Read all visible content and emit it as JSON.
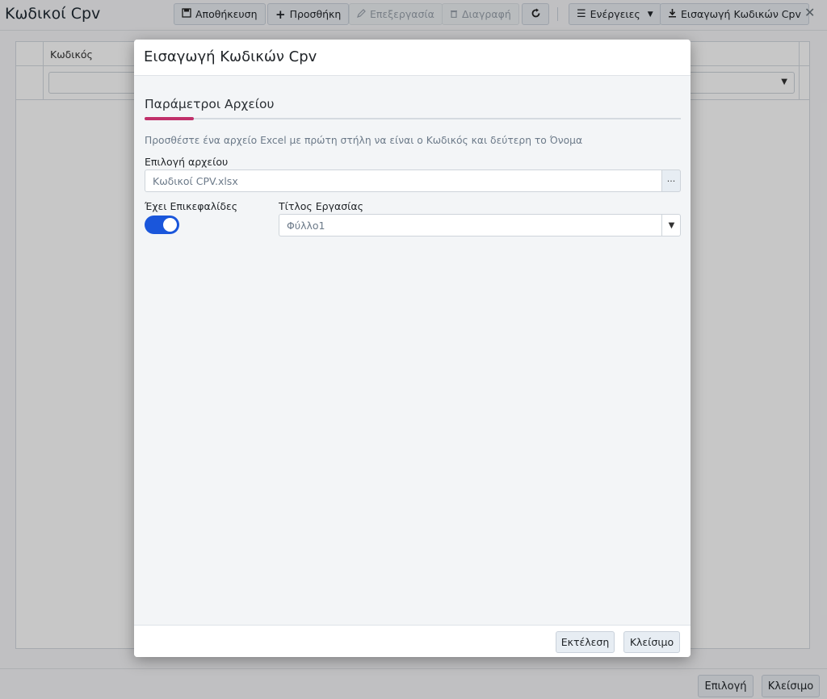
{
  "app": {
    "title": "Κωδικοί Cpv",
    "close_glyph": "✕"
  },
  "toolbar": {
    "save": {
      "label": "Αποθήκευση",
      "icon": "save-icon"
    },
    "add": {
      "label": "Προσθήκη",
      "icon": "plus-icon"
    },
    "edit": {
      "label": "Επεξεργασία",
      "icon": "pencil-icon",
      "disabled": true
    },
    "delete": {
      "label": "Διαγραφή",
      "icon": "trash-icon",
      "disabled": true
    },
    "refresh": {
      "icon": "refresh-icon"
    },
    "actions": {
      "label": "Ενέργειες",
      "icon": "menu-icon"
    },
    "import": {
      "label": "Εισαγωγή Κωδικών Cpv",
      "icon": "download-icon"
    }
  },
  "grid": {
    "columns": [
      "Κωδικός"
    ]
  },
  "bottom": {
    "select_label": "Επιλογή",
    "close_label": "Κλείσιμο"
  },
  "modal": {
    "title": "Εισαγωγή Κωδικών Cpv",
    "section_title": "Παράμετροι Αρχείου",
    "hint": "Προσθέστε ένα αρχείο Excel με πρώτη στήλη να είναι ο Κωδικός και δεύτερη το Όνομα",
    "file_label": "Επιλογή αρχείου",
    "file_value": "Κωδικοί CPV.xlsx",
    "file_button": "···",
    "headers_label": "Έχει Επικεφαλίδες",
    "headers_on": true,
    "sheet_label": "Τίτλος Εργασίας",
    "sheet_value": "Φύλλο1",
    "execute_label": "Εκτέλεση",
    "close_label": "Κλείσιμο"
  },
  "colors": {
    "accent": "#c0306a",
    "toggle": "#1a56db"
  }
}
